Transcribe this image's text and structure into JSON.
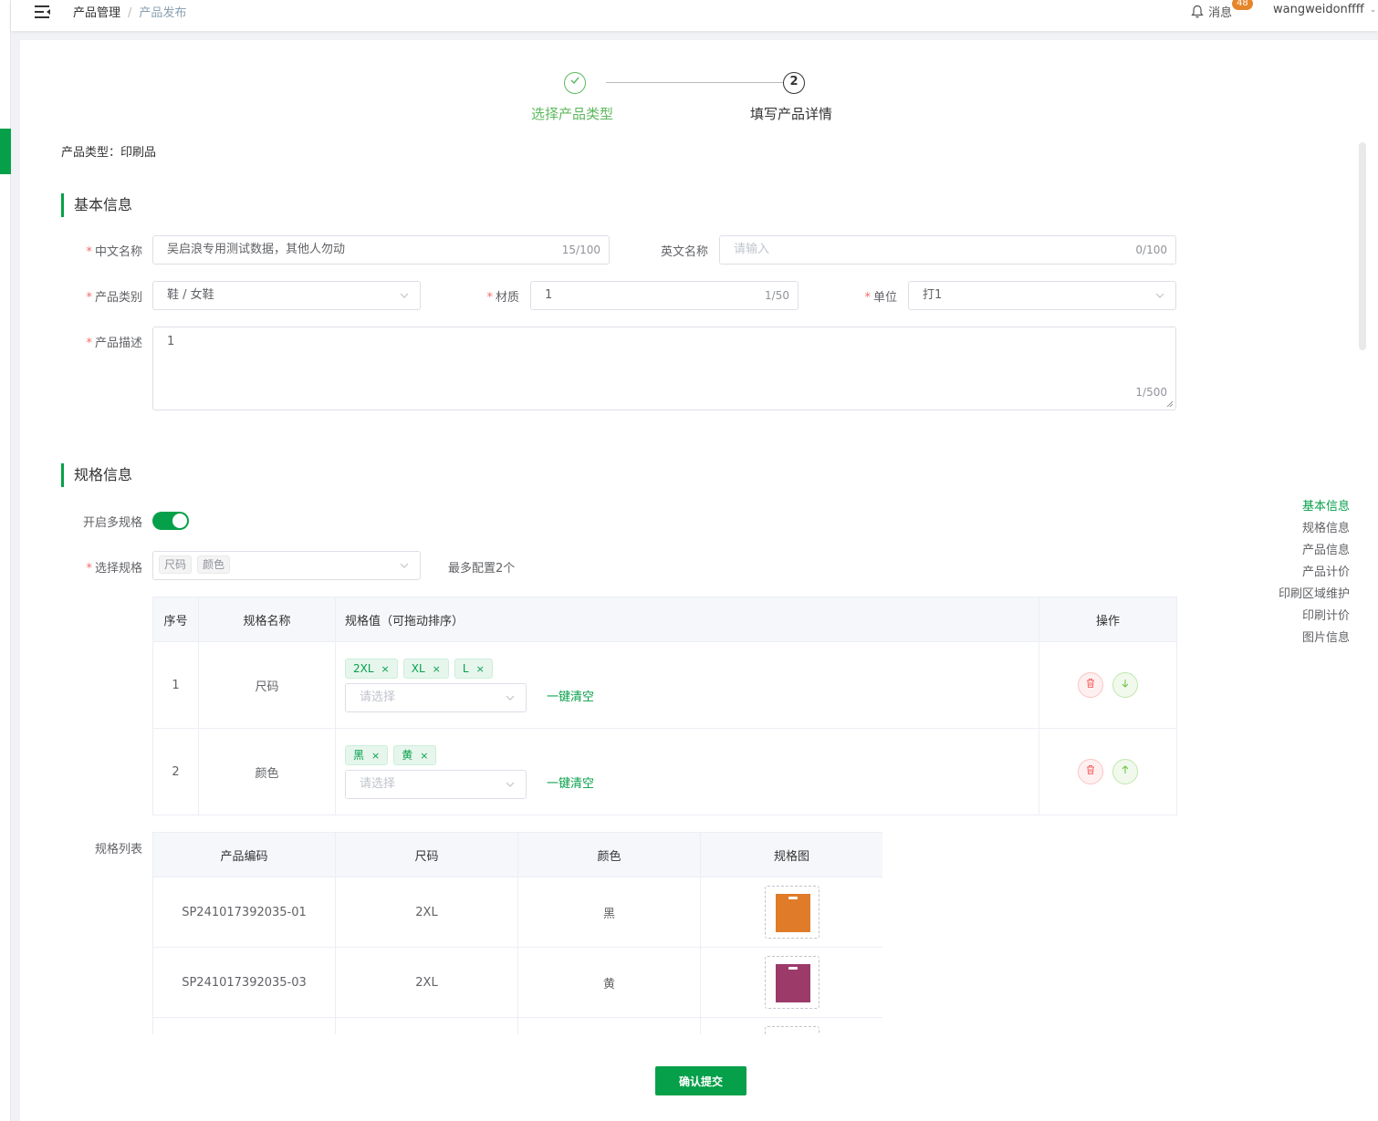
{
  "header": {
    "breadcrumb": [
      "产品管理",
      "产品发布"
    ],
    "breadcrumb_sep": "/",
    "notice_label": "消息",
    "notice_badge": "48",
    "username": "wangweidonffff"
  },
  "steps": [
    {
      "title": "选择产品类型",
      "status": "done"
    },
    {
      "number": "2",
      "title": "填写产品详情",
      "status": "current"
    }
  ],
  "product_type": "产品类型：印刷品",
  "basic": {
    "title": "基本信息",
    "cn_name": {
      "label": "中文名称",
      "value": "吴启浪专用测试数据，其他人勿动",
      "count": "15/100"
    },
    "en_name": {
      "label": "英文名称",
      "placeholder": "请输入",
      "count": "0/100"
    },
    "category": {
      "label": "产品类别",
      "value": "鞋 / 女鞋"
    },
    "material": {
      "label": "材质",
      "value": "1",
      "count": "1/50"
    },
    "unit": {
      "label": "单位",
      "value": "打1"
    },
    "desc": {
      "label": "产品描述",
      "value": "1",
      "count": "1/500"
    }
  },
  "spec": {
    "title": "规格信息",
    "multi_label": "开启多规格",
    "multi_enabled": true,
    "select_label": "选择规格",
    "selected": [
      "尺码",
      "颜色"
    ],
    "max_hint": "最多配置2个",
    "table_headers": [
      "序号",
      "规格名称",
      "规格值（可拖动排序）",
      "操作"
    ],
    "rows": [
      {
        "index": "1",
        "name": "尺码",
        "values": [
          "2XL",
          "XL",
          "L"
        ],
        "placeholder": "请选择",
        "clear": "一键清空"
      },
      {
        "index": "2",
        "name": "颜色",
        "values": [
          "黑",
          "黄"
        ],
        "placeholder": "请选择",
        "clear": "一键清空"
      }
    ],
    "list_label": "规格列表",
    "list_headers": [
      "产品编码",
      "尺码",
      "颜色",
      "规格图"
    ],
    "list_rows": [
      {
        "code": "SP241017392035-01",
        "size": "2XL",
        "color": "黑",
        "image_color": "#e07b2a"
      },
      {
        "code": "SP241017392035-03",
        "size": "2XL",
        "color": "黄",
        "image_color": "#9c3a6a"
      },
      {
        "code": "",
        "size": "",
        "color": "",
        "image_color": "#333333"
      }
    ]
  },
  "anchors": [
    "基本信息",
    "规格信息",
    "产品信息",
    "产品计价",
    "印刷区域维护",
    "印刷计价",
    "图片信息"
  ],
  "submit_label": "确认提交",
  "colors": {
    "brand": "#07a04a",
    "done": "#5cb85c",
    "badge": "#e6862b"
  }
}
